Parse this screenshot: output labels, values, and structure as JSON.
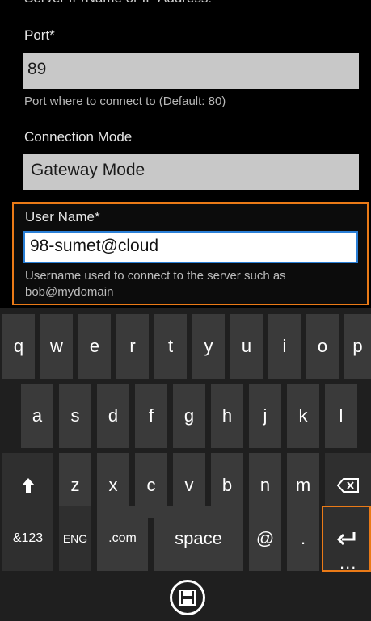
{
  "form": {
    "cut_off_text": "Server IP/Name or IP Address:",
    "port": {
      "label": "Port*",
      "value": "89",
      "hint": "Port where to connect to (Default: 80)"
    },
    "connection_mode": {
      "label": "Connection Mode",
      "value": "Gateway Mode"
    },
    "user_name": {
      "label": "User Name*",
      "value": "98-sumet@cloud",
      "hint": "Username used to connect to the server such as bob@mydomain"
    }
  },
  "keyboard": {
    "row1": [
      "q",
      "w",
      "e",
      "r",
      "t",
      "y",
      "u",
      "i",
      "o",
      "p"
    ],
    "row2": [
      "a",
      "s",
      "d",
      "f",
      "g",
      "h",
      "j",
      "k",
      "l"
    ],
    "row3": [
      "z",
      "x",
      "c",
      "v",
      "b",
      "n",
      "m"
    ],
    "row4": {
      "num": "&123",
      "lang": "ENG",
      "com": ".com",
      "space": "space",
      "at": "@",
      "dot": "."
    }
  },
  "app_bar": {
    "more": "...",
    "save_icon": "floppy-disk-icon"
  },
  "colors": {
    "accent_orange": "#ea7a17",
    "focus_blue": "#2a7fd6",
    "field_gray": "#c8c8c8",
    "key_gray": "#3a3a3a"
  }
}
